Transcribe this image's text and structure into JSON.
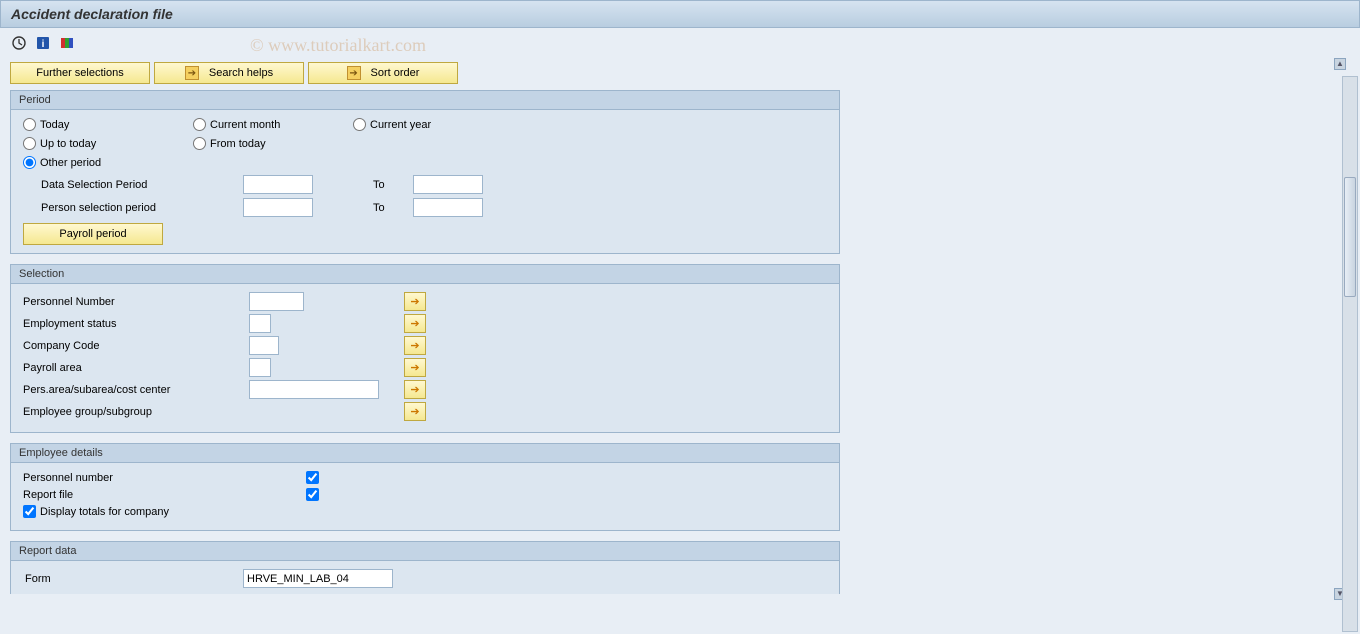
{
  "title": "Accident declaration file",
  "watermark": "© www.tutorialkart.com",
  "toolbar_buttons": {
    "further_selections": "Further selections",
    "search_helps": "Search helps",
    "sort_order": "Sort order"
  },
  "period": {
    "legend": "Period",
    "radios": {
      "today": "Today",
      "current_month": "Current month",
      "current_year": "Current year",
      "up_to_today": "Up to today",
      "from_today": "From today",
      "other_period": "Other period"
    },
    "data_selection_period_label": "Data Selection Period",
    "person_selection_period_label": "Person selection period",
    "to_label": "To",
    "payroll_period_btn": "Payroll period"
  },
  "selection": {
    "legend": "Selection",
    "personnel_number": "Personnel Number",
    "employment_status": "Employment status",
    "company_code": "Company Code",
    "payroll_area": "Payroll area",
    "pers_area": "Pers.area/subarea/cost center",
    "employee_group": "Employee group/subgroup"
  },
  "employee_details": {
    "legend": "Employee details",
    "personnel_number": "Personnel number",
    "report_file": "Report file",
    "display_totals": "Display totals for company"
  },
  "report_data": {
    "legend": "Report data",
    "form_label": "Form",
    "form_value": "HRVE_MIN_LAB_04"
  }
}
